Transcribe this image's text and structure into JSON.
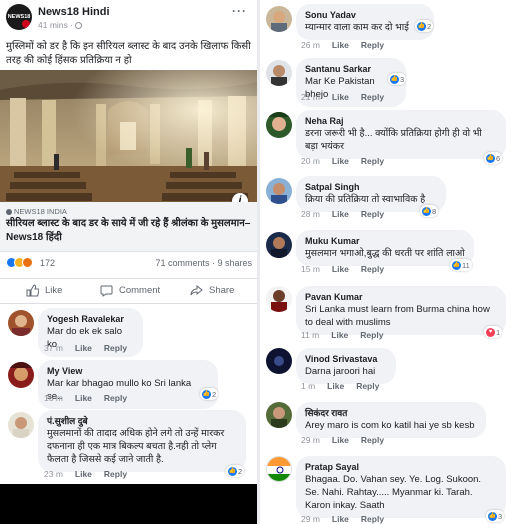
{
  "post": {
    "page_name": "News18 Hindi",
    "time": "41 mins ·",
    "logo_text": "NEWS18",
    "text": "मुस्लिमों को डर है कि इन सीरियल ब्लास्ट के बाद उनके खिलाफ किसी तरह की कोई हिंसक प्रतिक्रिया न हो",
    "link_source": "NEWS18 INDIA",
    "link_title": "सीरियल ब्लास्ट के बाद डर के साये में जी रहे हैं श्रीलंका के मुसलमान– News18 हिंदी",
    "reaction_count": "172",
    "comments_shares": "71 comments · 9 shares",
    "actions": {
      "like": "Like",
      "comment": "Comment",
      "share": "Share"
    }
  },
  "left_comments": [
    {
      "name": "Yogesh Ravalekar",
      "text": "Mar do ek ek salo ko",
      "time": "37 m",
      "like": "Like",
      "reply": "Reply"
    },
    {
      "name": "My View",
      "text": "Mar kar bhagao mullo ko Sri lanka se..",
      "time": "16 m",
      "like": "Like",
      "reply": "Reply",
      "likes": "2"
    },
    {
      "name": "पं.सुशील दुबे",
      "text": "मुसलमानों की तादाद अधिक होने लगे तो उन्हें मारकर दफनाना ही एक मात्र बिकल्प बचता है.नही तो प्लेग फैलता है जिससे कई जाने जाती है.",
      "time": "23 m",
      "like": "Like",
      "reply": "Reply",
      "likes": "2"
    }
  ],
  "right_comments": [
    {
      "name": "Sonu Yadav",
      "text": "म्यान्मार वाला काम कर दो भाई",
      "time": "26 m",
      "like": "Like",
      "reply": "Reply",
      "likes": "2"
    },
    {
      "name": "Santanu Sarkar",
      "text": "Mar Ke Pakistan bhejo",
      "time": "21 m",
      "like": "Like",
      "reply": "Reply",
      "likes": "3"
    },
    {
      "name": "Neha Raj",
      "text": "डरना जरूरी भी है... क्योंकि प्रतिक्रिया होगी ही वो भी बड़ा भयंकर",
      "time": "20 m",
      "like": "Like",
      "reply": "Reply",
      "likes": "6"
    },
    {
      "name": "Satpal Singh",
      "text": "क्रिया की प्रतिक्रिया तो स्वाभाविक है",
      "time": "28 m",
      "like": "Like",
      "reply": "Reply",
      "likes": "8"
    },
    {
      "name": "Muku Kumar",
      "text": "मुसलमान भगाओ,बुद्ध की धरती पर शांति लाओ",
      "time": "15 m",
      "like": "Like",
      "reply": "Reply",
      "likes": "11"
    },
    {
      "name": "Pavan Kumar",
      "text": "Sri Lanka must learn from Burma china how to deal with muslims",
      "time": "11 m",
      "like": "Like",
      "reply": "Reply",
      "likes": "1"
    },
    {
      "name": "Vinod Srivastava",
      "text": "Darna jaroori hai",
      "time": "1 m",
      "like": "Like",
      "reply": "Reply"
    },
    {
      "name": "सिकंदर रावत",
      "text": "Arey maro is com ko katil hai ye sb kesb",
      "time": "29 m",
      "like": "Like",
      "reply": "Reply"
    },
    {
      "name": "Pratap Sayal",
      "text": "Bhagaa. Do. Vahan sey. Ye. Log. Sukoon. Se. Nahi. Rahtay..... Myanmar ki. Tarah. Karon inkay. Saath",
      "time": "29 m",
      "like": "Like",
      "reply": "Reply",
      "likes": "3"
    }
  ],
  "colors": {
    "accent": "#1877f2",
    "love": "#f33e58",
    "bubble": "#f0f2f5",
    "meta": "#90949c"
  }
}
